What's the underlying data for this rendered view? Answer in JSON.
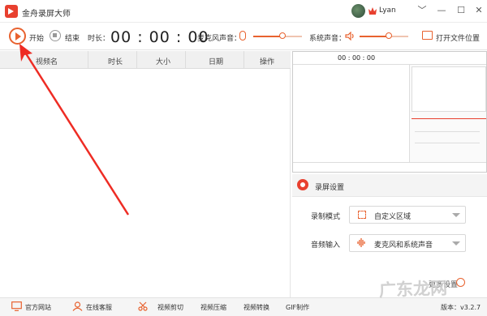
{
  "titlebar": {
    "app_title": "金舟录屏大师",
    "user_name": "Lyan",
    "controls": [
      "﹀",
      "—",
      "☐",
      "✕"
    ]
  },
  "toolbar": {
    "start_label": "开始",
    "stop_label": "结束",
    "duration_label": "时长：",
    "timer": "00 : 00 : 00",
    "mic_label": "麦克风声音：",
    "mic_level": 0.6,
    "system_label": "系统声音：",
    "system_level": 0.6,
    "open_folder_label": "打开文件位置"
  },
  "file_list": {
    "columns": [
      "视频名",
      "时长",
      "大小",
      "日期",
      "操作"
    ],
    "rows": []
  },
  "preview": {
    "timer": "00 : 00 : 00"
  },
  "settings": {
    "title": "录屏设置",
    "record_mode_label": "录制模式",
    "record_mode_value": "自定义区域",
    "audio_input_label": "音频输入",
    "audio_input_value": "麦克风和系统声音",
    "more_settings": "更多设置"
  },
  "statusbar": {
    "website": "官方网站",
    "support": "在线客服",
    "video_cut": "视频剪切",
    "video_compress": "视频压缩",
    "video_convert": "视频转换",
    "gif": "GIF制作",
    "version": "版本：v3.2.7"
  },
  "watermark": "广东龙网",
  "colors": {
    "accent": "#e8622f",
    "brand": "#e8402f",
    "annotation_arrow": "#ee2c24"
  }
}
